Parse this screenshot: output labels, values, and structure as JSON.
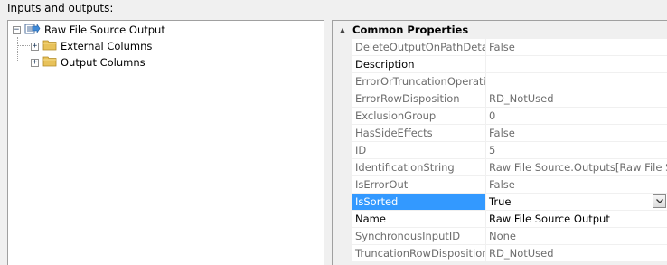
{
  "panel_title": "Inputs and outputs:",
  "tree": {
    "root": {
      "label": "Raw File Source Output",
      "expander": "−"
    },
    "children": [
      {
        "label": "External Columns",
        "expander": "+"
      },
      {
        "label": "Output Columns",
        "expander": "+"
      }
    ]
  },
  "properties": {
    "category": {
      "label": "Common Properties",
      "toggle": "▲"
    },
    "rows": [
      {
        "name": "DeleteOutputOnPathDetach",
        "value": "False",
        "state": "readonly"
      },
      {
        "name": "Description",
        "value": "",
        "state": "editable"
      },
      {
        "name": "ErrorOrTruncationOperation",
        "value": "",
        "state": "readonly"
      },
      {
        "name": "ErrorRowDisposition",
        "value": "RD_NotUsed",
        "state": "readonly"
      },
      {
        "name": "ExclusionGroup",
        "value": "0",
        "state": "readonly"
      },
      {
        "name": "HasSideEffects",
        "value": "False",
        "state": "readonly"
      },
      {
        "name": "ID",
        "value": "5",
        "state": "readonly"
      },
      {
        "name": "IdentificationString",
        "value": "Raw File Source.Outputs[Raw File S",
        "state": "readonly"
      },
      {
        "name": "IsErrorOut",
        "value": "False",
        "state": "readonly"
      },
      {
        "name": "IsSorted",
        "value": "True",
        "state": "selected"
      },
      {
        "name": "Name",
        "value": "Raw File Source Output",
        "state": "editable"
      },
      {
        "name": "SynchronousInputID",
        "value": "None",
        "state": "readonly"
      },
      {
        "name": "TruncationRowDisposition",
        "value": "RD_NotUsed",
        "state": "readonly"
      }
    ]
  },
  "colors": {
    "selection": "#3399ff",
    "readonly_text": "#6d6d6d",
    "grid_background": "#f0f0f0",
    "folder": "#e8c25a"
  },
  "icons": {
    "root": "output-icon",
    "children": "folder-icon",
    "dropdown": "chevron-down-icon"
  }
}
